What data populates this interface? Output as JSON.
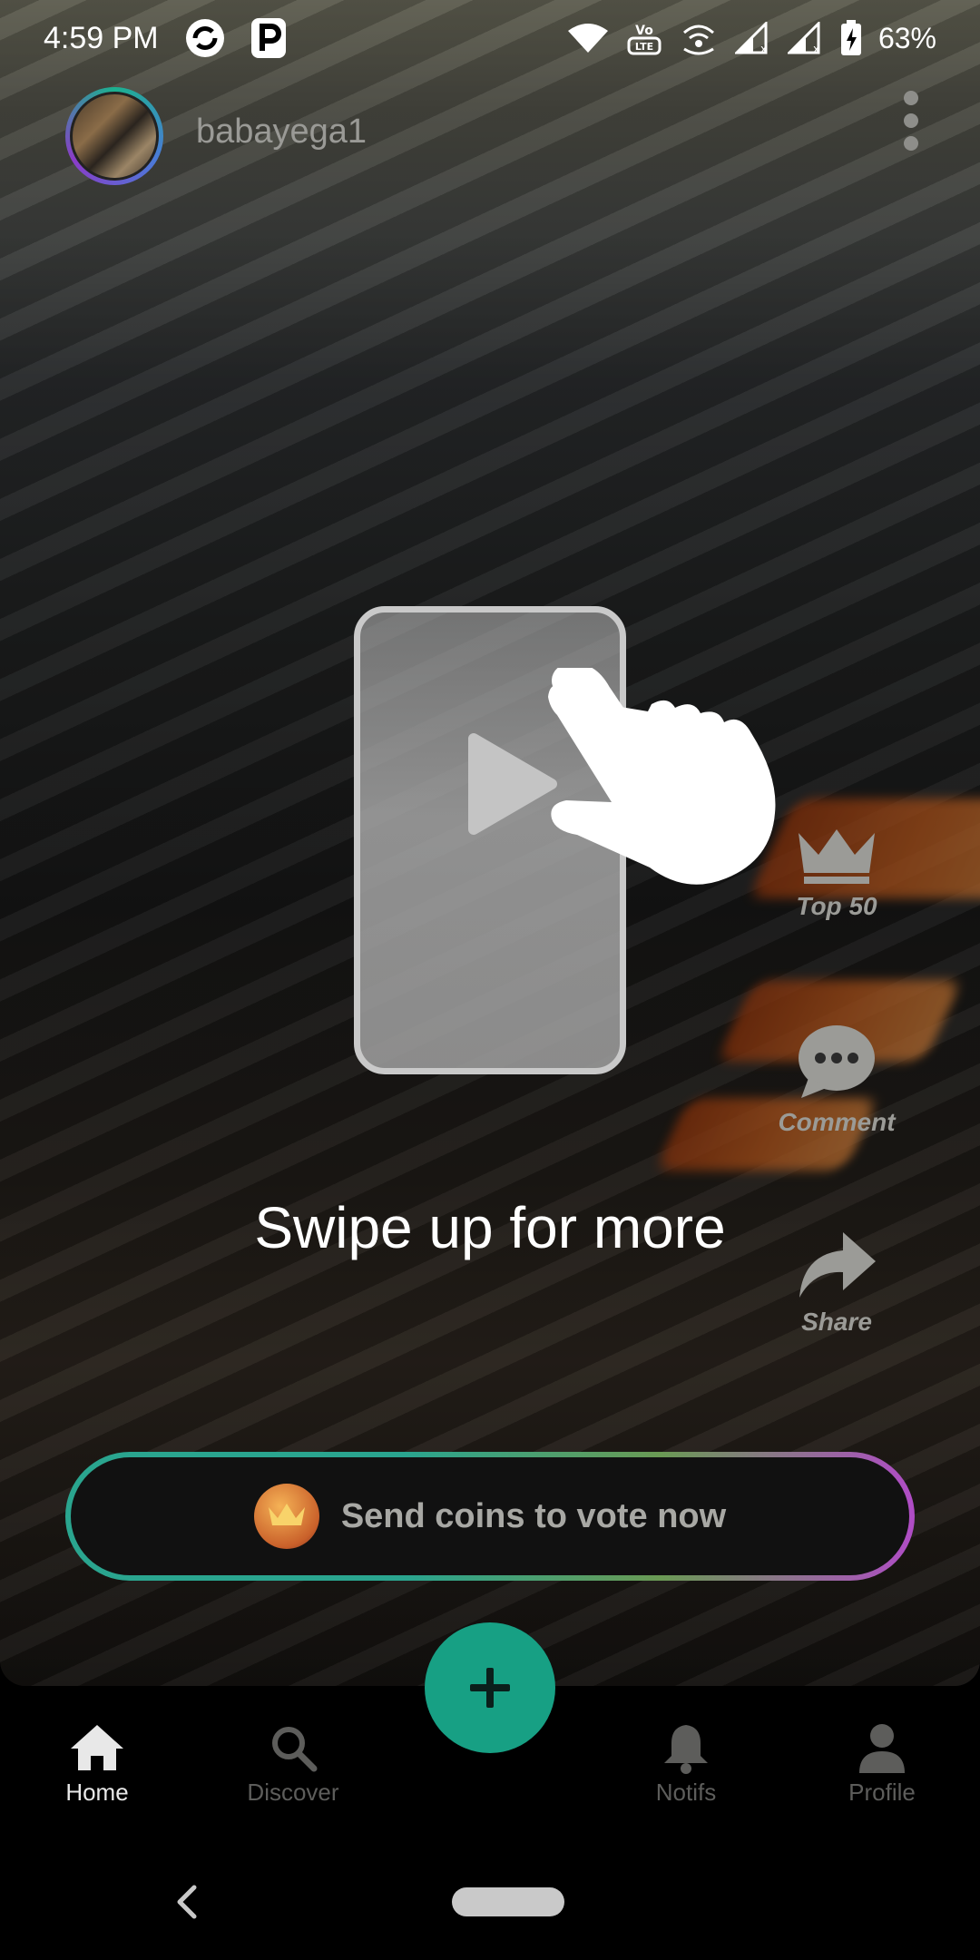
{
  "status_bar": {
    "time": "4:59 PM",
    "battery": "63%",
    "volte_label": "VoLTE"
  },
  "header": {
    "username": "babayega1"
  },
  "swipe_hint": {
    "text": "Swipe up for more"
  },
  "actions": {
    "top50": "Top 50",
    "comment": "Comment",
    "share": "Share"
  },
  "vote": {
    "label": "Send coins to vote now"
  },
  "bottom_nav": {
    "items": [
      {
        "label": "Home",
        "icon": "home-icon",
        "active": true
      },
      {
        "label": "Discover",
        "icon": "search-icon",
        "active": false
      },
      {
        "label": "Notifs",
        "icon": "bell-icon",
        "active": false
      },
      {
        "label": "Profile",
        "icon": "person-icon",
        "active": false
      }
    ]
  },
  "colors": {
    "accent": "#17a084",
    "ring_green": "#2aa58f",
    "ring_purple": "#b04cc6"
  }
}
